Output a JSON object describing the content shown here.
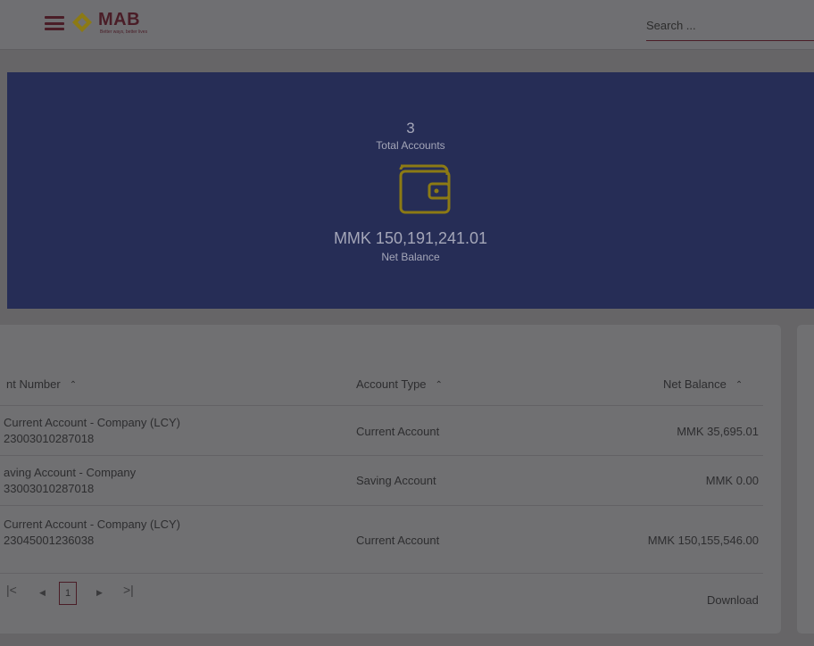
{
  "header": {
    "brand": "MAB",
    "tagline": "Better ways, better lives",
    "search_placeholder": "Search ..."
  },
  "summary": {
    "total_accounts": "3",
    "total_accounts_label": "Total Accounts",
    "net_balance": "MMK 150,191,241.01",
    "net_balance_label": "Net Balance"
  },
  "table": {
    "columns": [
      "nt Number",
      "Account Type",
      "Net Balance"
    ],
    "rows": [
      {
        "name": "Current Account - Company (LCY)",
        "number": "23003010287018",
        "type": "Current Account",
        "balance": "MMK 35,695.01"
      },
      {
        "name": "aving Account - Company",
        "number": "33003010287018",
        "type": "Saving Account",
        "balance": "MMK 0.00"
      },
      {
        "name": "Current Account - Company (LCY)",
        "number": "23045001236038",
        "type": "Current Account",
        "balance": "MMK 150,155,546.00"
      }
    ]
  },
  "pagination": {
    "first": "|<",
    "prev": "◀",
    "current": "1",
    "next": "▶",
    "last": ">|",
    "download_label": "Download"
  },
  "colors": {
    "banner": "#262d56",
    "accent": "#4a1d27",
    "wallet": "#8c7a14"
  }
}
